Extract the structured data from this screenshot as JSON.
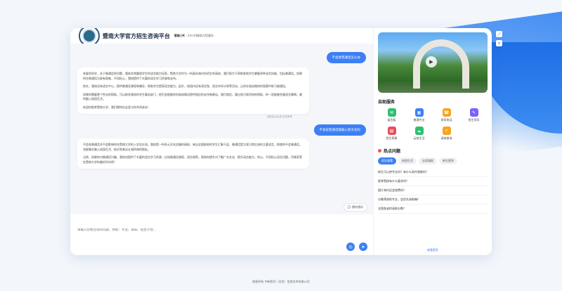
{
  "header": {
    "title": "暨南大学官方招生咨询平台",
    "subtitle_bold": "智能小K",
    "subtitle": "· 24小时精准为您服务 ·"
  },
  "messages": [
    {
      "role": "user",
      "text": "不会讲普通话怎么办"
    },
    {
      "role": "bot",
      "paragraphs": [
        "亲爱的同学，关于普通话的问题，我校非常重视学生的语言能力培养。暨南大学作为一所面向海内外招生的高校，我们致力于帮助各地学生掌握多种语言技能，包括普通话。如果你在普通话方面有困难，不用担心，我校提供了丰富的语言学习资源和支持。",
        "首先，我校设有语言中心，提供普通话课程和辅导，帮助学生提高语言能力。此外，校园内还有语言角、语言伙伴计划等活动，让你在轻松愉快的氛围中练习普通话。",
        "如果你需要更个性化的帮助，可以联系我校的学生事务部门，他们会根据你的具体情况提供相应的支持和建议。我们相信，通过努力和学校的帮助，你一定能够克服语言障碍，顺利融入校园生活。",
        "欢迎你报考暨南大学，我们期待在这里与你共同成长！"
      ]
    },
    {
      "role": "meta",
      "text": "回答由AI生成 仅供参考"
    },
    {
      "role": "user",
      "text": "不会说普通话能融入新文化吗"
    },
    {
      "role": "bot",
      "paragraphs": [
        "不会说普通话并不会影响你在暨南大学的入学及交流，我校是一所多元文化交融的高校，来自全国各地的学生汇聚于此。普通话是大家日常交流的主要语言，即使你不会普通话，也能够在融入校园生活、结交到来自五湖四海的朋友。",
        "当然，如果你对普通话兴趣，我校也提供了丰富的语言学习资源，比如普通话课程、语言角等，帮助你提升对了解广东文化、提升语言能力。所以，不用担心语言问题，尽情享受在暨南大学的美好时光吧！"
      ]
    }
  ],
  "hint_button": "猜你想问",
  "input": {
    "placeholder": "请输入您想咨询的问题，例如：专业、录取、招生计划..."
  },
  "side": {
    "services_title": "自助服务",
    "services": [
      {
        "label": "留言板",
        "icon": "message-board-icon",
        "color": "#2fbf71",
        "glyph": "✉"
      },
      {
        "label": "普通专业",
        "icon": "major-icon",
        "color": "#3d7ff5",
        "glyph": "▦"
      },
      {
        "label": "常用电话",
        "icon": "phone-icon",
        "color": "#f5a524",
        "glyph": "☎"
      },
      {
        "label": "招生资讯",
        "icon": "news-icon",
        "color": "#7b61ff",
        "glyph": "✎"
      },
      {
        "label": "招生简章",
        "icon": "brochure-icon",
        "color": "#e8505b",
        "glyph": "▤"
      },
      {
        "label": "云校生活",
        "icon": "campus-life-icon",
        "color": "#2fbf71",
        "glyph": "☁"
      },
      {
        "label": "录取查询",
        "icon": "admission-query-icon",
        "color": "#f5a524",
        "glyph": "⌕"
      }
    ],
    "hot_title": "热点问题",
    "chips": [
      "招生政策",
      "校园生活",
      "志愿填报",
      "新生报到"
    ],
    "questions": [
      "新生可以转专业吗？有什么条件限制吗？",
      "报考暨校有什么要求吗？",
      "图片海内还会收费吗？",
      "分数预测的专业，会优先录取嘛？",
      "全国各省的录取分数？"
    ],
    "more": "查看更多"
  },
  "footer": "版权所有 中新智问（北京）信息技术有限公司"
}
